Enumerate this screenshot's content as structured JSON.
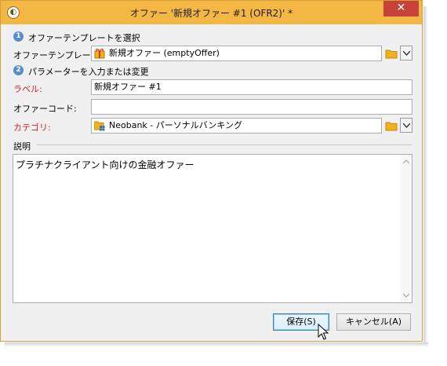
{
  "window": {
    "title": "オファー '新規オファー #1 (OFR2)' *",
    "close_glyph": "✕",
    "accent": "#f4b743"
  },
  "step1": {
    "number": "1",
    "title": "オファーテンプレートを選択",
    "template_label": "オファーテンプレート:",
    "template_value": "新規オファー (emptyOffer)",
    "icon": "offer-template-icon"
  },
  "step2": {
    "number": "2",
    "title": "パラメーターを入力または変更",
    "label_label": "ラベル:",
    "label_value": "新規オファー #1",
    "code_label": "オファーコード:",
    "code_value": "",
    "category_label": "カテゴリ:",
    "category_value": "Neobank - パーソナルバンキング",
    "category_icon": "category-folder-icon"
  },
  "description": {
    "label": "説明",
    "value": "プラチナクライアント向けの金融オファー"
  },
  "buttons": {
    "save": "保存(S)",
    "cancel": "キャンセル(A)"
  }
}
